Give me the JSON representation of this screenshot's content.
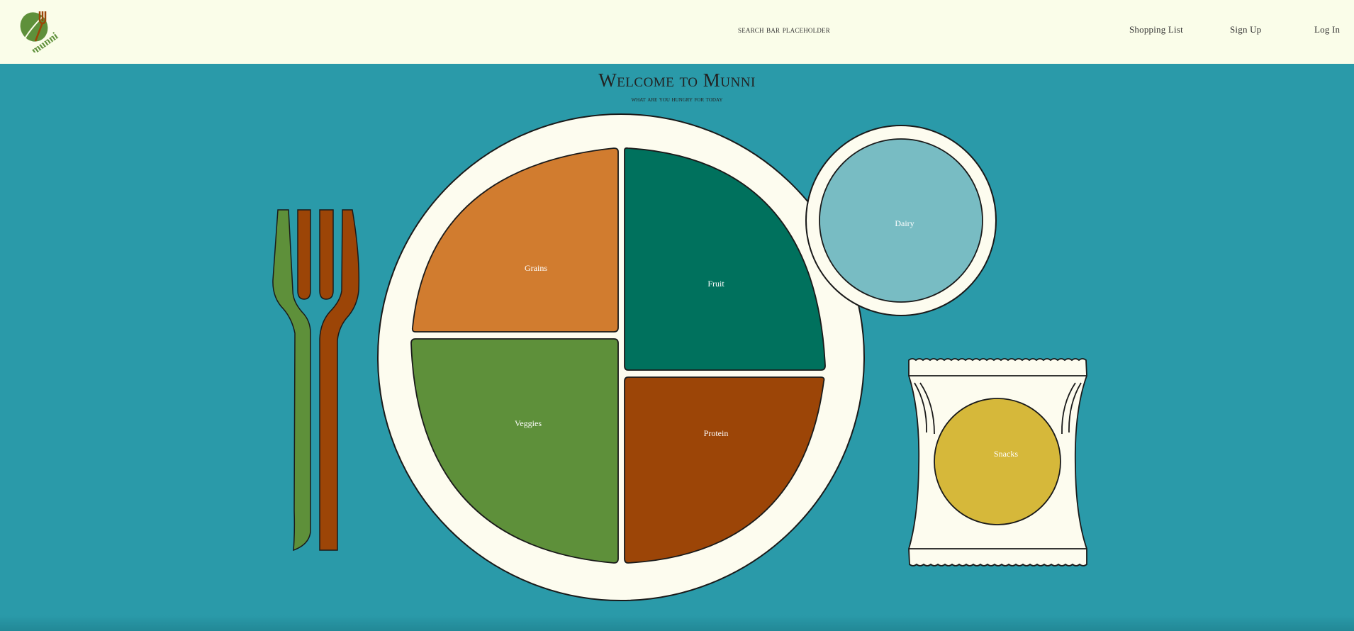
{
  "header": {
    "logo_text": "munni",
    "search_placeholder": "search bar placeholder",
    "nav": [
      "Shopping List",
      "Sign Up",
      "Log In"
    ]
  },
  "main": {
    "title": "Welcome to Munni",
    "subtitle": "what are you hungry for today"
  },
  "plate": {
    "sections": [
      "Grains",
      "Fruit",
      "Veggies",
      "Protein"
    ],
    "dairy_label": "Dairy",
    "snacks_label": "Snacks"
  },
  "colors": {
    "background": "#2a9aa9",
    "nav_bg": "#fafde9",
    "grains": "#d17c2f",
    "fruit": "#00715d",
    "veggies": "#5e903a",
    "protein": "#9c4507",
    "dairy": "#78bcc3",
    "snacks": "#d6b83a",
    "plate": "#fdfcef"
  }
}
